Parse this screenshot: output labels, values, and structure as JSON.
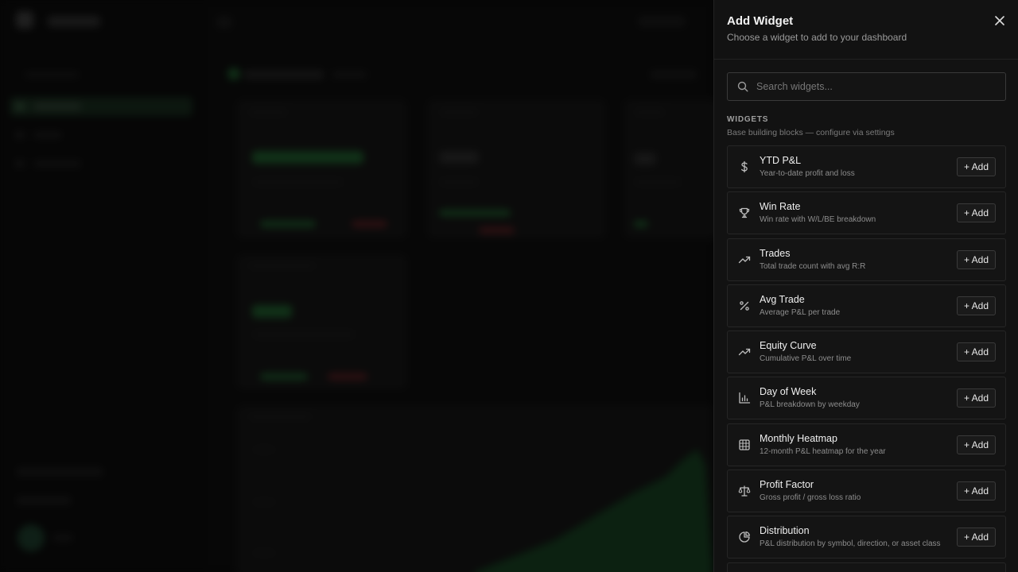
{
  "panel": {
    "title": "Add Widget",
    "subtitle": "Choose a widget to add to your dashboard",
    "search_placeholder": "Search widgets...",
    "section_title": "WIDGETS",
    "section_desc": "Base building blocks — configure via settings",
    "add_label": "+ Add",
    "widgets": [
      {
        "name": "YTD P&L",
        "desc": "Year-to-date profit and loss",
        "icon": "dollar-icon"
      },
      {
        "name": "Win Rate",
        "desc": "Win rate with W/L/BE breakdown",
        "icon": "trophy-icon"
      },
      {
        "name": "Trades",
        "desc": "Total trade count with avg R:R",
        "icon": "trending-up-icon"
      },
      {
        "name": "Avg Trade",
        "desc": "Average P&L per trade",
        "icon": "percent-icon"
      },
      {
        "name": "Equity Curve",
        "desc": "Cumulative P&L over time",
        "icon": "trending-up-icon"
      },
      {
        "name": "Day of Week",
        "desc": "P&L breakdown by weekday",
        "icon": "bar-chart-icon"
      },
      {
        "name": "Monthly Heatmap",
        "desc": "12-month P&L heatmap for the year",
        "icon": "grid-icon"
      },
      {
        "name": "Profit Factor",
        "desc": "Gross profit / gross loss ratio",
        "icon": "scale-icon"
      },
      {
        "name": "Distribution",
        "desc": "P&L distribution by symbol, direction, or asset class",
        "icon": "pie-chart-icon"
      }
    ]
  }
}
